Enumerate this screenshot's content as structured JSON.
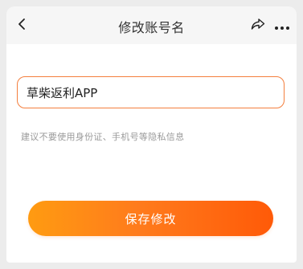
{
  "header": {
    "title": "修改账号名",
    "back_icon": "chevron-left-icon",
    "share_icon": "share-icon",
    "more_icon": "more-dots-icon"
  },
  "form": {
    "name_value": "草柴返利APP",
    "hint": "建议不要使用身份证、手机号等隐私信息"
  },
  "actions": {
    "save_label": "保存修改"
  },
  "colors": {
    "accent": "#ff7b1c",
    "gradient_start": "#ff9b11",
    "gradient_end": "#ff5a08",
    "input_border": "#f47f3e"
  }
}
